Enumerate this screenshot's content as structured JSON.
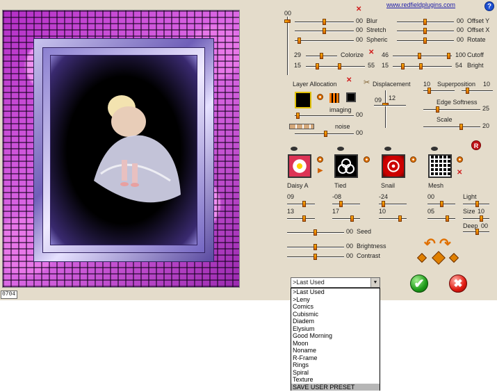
{
  "header": {
    "link_text": "www.redfieldplugins.com",
    "help_label": "?"
  },
  "colors": {
    "accent": "#e07000",
    "panel_bg": "#e4dccb",
    "ok": "#1e9b1a",
    "cancel": "#e01a10"
  },
  "top_sliders": {
    "master_value": "00",
    "blur": {
      "label": "Blur",
      "value": "00"
    },
    "stretch": {
      "label": "Stretch",
      "value": "00"
    },
    "spheric": {
      "label": "Spheric",
      "value": "00"
    },
    "offset_y": {
      "label": "Offset Y",
      "value": "00"
    },
    "offset_x": {
      "label": "Offset X",
      "value": "00"
    },
    "rotate": {
      "label": "Rotate",
      "value": "00"
    },
    "colorize": {
      "label": "Colorize",
      "left_value": "29",
      "left_value2": "15",
      "right_value": "55"
    },
    "cutoff": {
      "label": "Cutoff",
      "left_value": "46",
      "right_value": "100"
    },
    "bright": {
      "label": "Bright",
      "left_value": "15",
      "right_value": "54"
    }
  },
  "layer_allocation": {
    "label": "Layer Allocation",
    "imaging_label": "imaging",
    "imaging_value": "00",
    "noise_label": "noise",
    "noise_value": "00"
  },
  "displacement": {
    "label": "Displacement",
    "value_left": "09",
    "value_right": "12",
    "superposition": {
      "label": "Superposition",
      "left_value": "10",
      "right_value": "10"
    },
    "edge_softness": {
      "label": "Edge Softness",
      "value": "25"
    },
    "scale": {
      "label": "Scale",
      "value": "20"
    }
  },
  "patterns": [
    {
      "name": "Daisy A",
      "icon": "daisy-icon"
    },
    {
      "name": "Tied",
      "icon": "celtic-knot-icon"
    },
    {
      "name": "Snail",
      "icon": "spiral-icon"
    },
    {
      "name": "Mesh",
      "icon": "mesh-icon"
    }
  ],
  "pattern_values": {
    "row1": [
      "09",
      "-08",
      "-24",
      "00"
    ],
    "row2": [
      "13",
      "17",
      "10",
      "05"
    ],
    "light": {
      "label": "Light"
    },
    "size": {
      "label": "Size",
      "value": "10"
    },
    "deep": {
      "label": "Deep",
      "value": "00"
    }
  },
  "bottom_sliders": {
    "seed": {
      "label": "Seed",
      "value": "00"
    },
    "brightness": {
      "label": "Brightness",
      "value": "00"
    },
    "contrast": {
      "label": "Contrast",
      "value": "00"
    }
  },
  "status": {
    "frame_number": "0704"
  },
  "preset": {
    "selected": ">Last Used",
    "options": [
      ">Last Used",
      ">Leny",
      "Comics",
      "Cubismic",
      "Diadem",
      "Elysium",
      "Good Morning",
      "Moon",
      "Noname",
      "R-Frame",
      "Rings",
      "Spiral",
      "Texture",
      "SAVE USER PRESET"
    ]
  },
  "rbutton_label": "R",
  "ok_label": "✔",
  "cancel_label": "✖"
}
